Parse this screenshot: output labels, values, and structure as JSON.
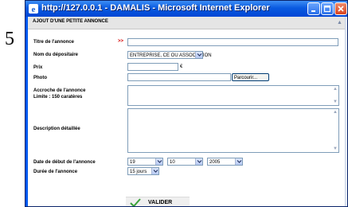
{
  "annotation": {
    "side_number": "5"
  },
  "window": {
    "title": "http://127.0.0.1 - DAMALIS - Microsoft Internet Explorer"
  },
  "page": {
    "heading": "AJOUT D'UNE PETITE ANNONCE"
  },
  "form": {
    "titre_label": "Titre de l'annonce",
    "required_marker": ">>",
    "titre_value": "",
    "depositaire_label": "Nom du dépositaire",
    "depositaire_value": "ENTREPRISE, CE OU ASSOCIATION",
    "prix_label": "Prix",
    "prix_value": "",
    "currency": "€",
    "photo_label": "Photo",
    "photo_value": "",
    "browse_label": "Parcourir...",
    "accroche_label_line1": "Accroche de l'annonce",
    "accroche_label_line2": "Limite : 150 caratères",
    "accroche_value": "",
    "description_label": "Description détaillée",
    "description_value": "",
    "date_label": "Date de début de l'annonce",
    "date_day": "19",
    "date_month": "10",
    "date_year": "2005",
    "duree_label": "Durée de l'annonce",
    "duree_value": "15 jours",
    "submit_label": "VALIDER"
  },
  "icons": {
    "window": "ie-icon",
    "minimize": "minimize-icon",
    "maximize": "maximize-icon",
    "close": "close-icon",
    "dropdown": "chevron-down-icon",
    "submit": "checkmark-icon"
  },
  "colors": {
    "titlebar": "#0058ee",
    "required_marker": "#d40000",
    "close_button": "#d8431e"
  }
}
